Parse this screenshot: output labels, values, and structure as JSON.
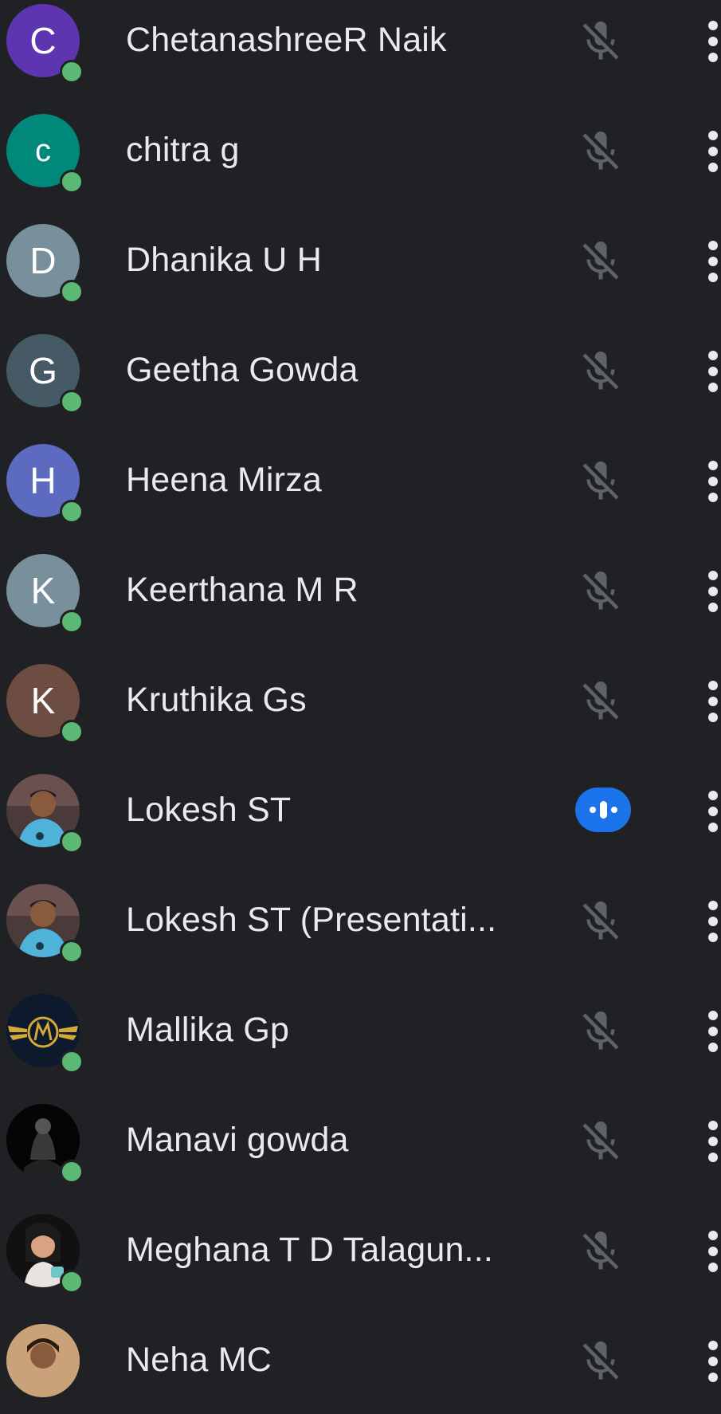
{
  "participants": [
    {
      "initial": "C",
      "name": "ChetanashreeR Naik",
      "color": "#5e35b1",
      "avatar_type": "letter",
      "online": true,
      "audio": "muted"
    },
    {
      "initial": "c",
      "name": "chitra g",
      "color": "#00897b",
      "avatar_type": "letter",
      "online": true,
      "audio": "muted"
    },
    {
      "initial": "D",
      "name": "Dhanika U H",
      "color": "#78909c",
      "avatar_type": "letter",
      "online": true,
      "audio": "muted"
    },
    {
      "initial": "G",
      "name": "Geetha Gowda",
      "color": "#455a64",
      "avatar_type": "letter",
      "online": true,
      "audio": "muted"
    },
    {
      "initial": "H",
      "name": "Heena Mirza",
      "color": "#5c6bc0",
      "avatar_type": "letter",
      "online": true,
      "audio": "muted"
    },
    {
      "initial": "K",
      "name": "Keerthana M R",
      "color": "#78909c",
      "avatar_type": "letter",
      "online": true,
      "audio": "muted"
    },
    {
      "initial": "K",
      "name": "Kruthika Gs",
      "color": "#6d4c41",
      "avatar_type": "letter",
      "online": true,
      "audio": "muted"
    },
    {
      "initial": "",
      "name": "Lokesh ST",
      "color": "#3b3f4a",
      "avatar_type": "photo",
      "online": true,
      "audio": "speaking"
    },
    {
      "initial": "",
      "name": "Lokesh ST (Presentati...",
      "color": "#3b3f4a",
      "avatar_type": "photo",
      "online": true,
      "audio": "muted"
    },
    {
      "initial": "",
      "name": "Mallika Gp",
      "color": "#0d1a2e",
      "avatar_type": "photo",
      "online": true,
      "audio": "muted"
    },
    {
      "initial": "",
      "name": "Manavi gowda",
      "color": "#0a0a0a",
      "avatar_type": "photo",
      "online": true,
      "audio": "muted"
    },
    {
      "initial": "",
      "name": "Meghana T D Talagun...",
      "color": "#111111",
      "avatar_type": "photo",
      "online": true,
      "audio": "muted"
    },
    {
      "initial": "",
      "name": "Neha MC",
      "color": "#c9a27a",
      "avatar_type": "photo",
      "online": false,
      "audio": "muted"
    }
  ],
  "icons": {
    "muted": "mic-off-icon",
    "speaking": "audio-level-icon",
    "more": "more-vert-icon",
    "online": "online-status-dot"
  },
  "colors": {
    "background": "#202124",
    "text": "#e8eaed",
    "mic_muted": "#5f6368",
    "speaking_accent": "#1a73e8",
    "online": "#5bb974"
  }
}
